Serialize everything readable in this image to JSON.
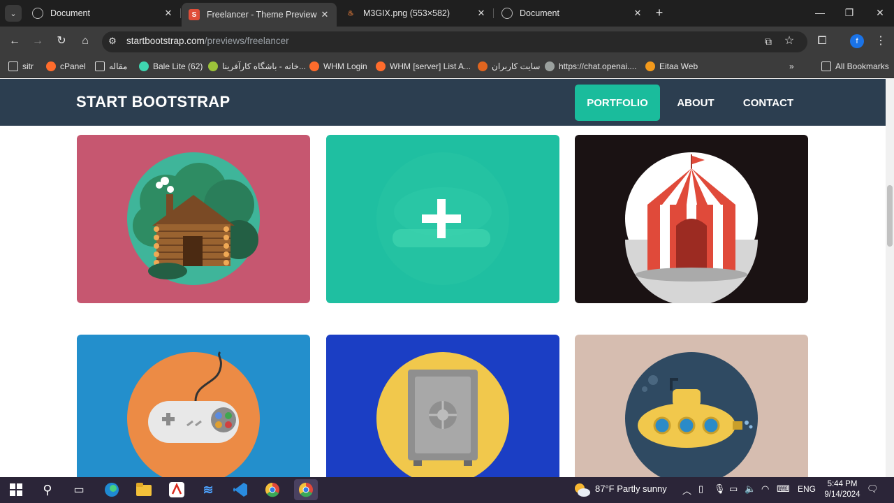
{
  "browser": {
    "tabs": [
      {
        "title": "Document",
        "favicon": "globe-icon"
      },
      {
        "title": "Freelancer - Theme Preview - St",
        "favicon": "startbootstrap-favicon",
        "active": true
      },
      {
        "title": "M3GIX.png (553×582)",
        "favicon": "image-favicon"
      },
      {
        "title": "Document",
        "favicon": "globe-icon"
      }
    ],
    "url_host": "startbootstrap.com",
    "url_path": "/previews/freelancer",
    "profile_initial": "f",
    "bookmarks": [
      {
        "label": "sitr",
        "icon": "folder-icon"
      },
      {
        "label": "cPanel",
        "icon": "cpanel-icon"
      },
      {
        "label": "مقاله",
        "icon": "folder-icon"
      },
      {
        "label": "Bale Lite (62)",
        "icon": "bale-icon"
      },
      {
        "label": "خانه - باشگاه کارآفرینا...",
        "icon": "club-icon"
      },
      {
        "label": "WHM Login",
        "icon": "cpanel-icon"
      },
      {
        "label": "WHM [server] List A...",
        "icon": "cpanel-icon"
      },
      {
        "label": "سایت کاربران",
        "icon": "apple-icon"
      },
      {
        "label": "https://chat.openai....",
        "icon": "openai-icon"
      },
      {
        "label": "Eitaa Web",
        "icon": "eitaa-icon"
      }
    ],
    "all_bookmarks": "All Bookmarks"
  },
  "site": {
    "brand": "START BOOTSTRAP",
    "nav": [
      {
        "label": "PORTFOLIO",
        "active": true
      },
      {
        "label": "ABOUT"
      },
      {
        "label": "CONTACT"
      }
    ],
    "accent": "#1abc9c",
    "navbar_color": "#2c3e50"
  },
  "portfolio": [
    {
      "name": "cabin",
      "bg": "#c65770"
    },
    {
      "name": "cake",
      "bg": "#1fbfa1",
      "hover": true
    },
    {
      "name": "circus",
      "bg": "#1a1213"
    },
    {
      "name": "game",
      "bg": "#238fcc"
    },
    {
      "name": "safe",
      "bg": "#1b3ec4"
    },
    {
      "name": "submarine",
      "bg": "#d6bdb0"
    }
  ],
  "taskbar": {
    "weather": "87°F  Partly sunny",
    "lang": "ENG",
    "time": "5:44 PM",
    "date": "9/14/2024"
  }
}
